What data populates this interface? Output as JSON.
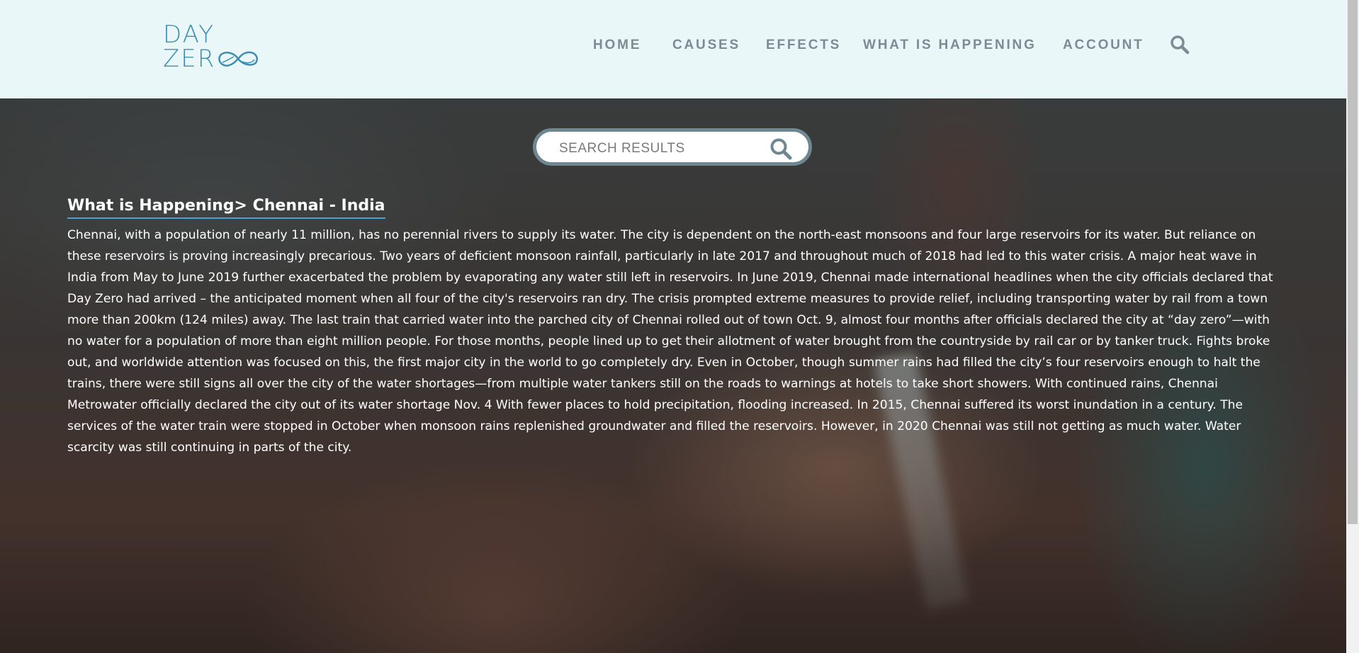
{
  "brand": {
    "line1": "DAY",
    "line2": "ZER"
  },
  "nav": {
    "items": [
      {
        "label": "HOME"
      },
      {
        "label": "CAUSES"
      },
      {
        "label": "EFFECTS"
      },
      {
        "label": "WHAT IS HAPPENING"
      },
      {
        "label": "ACCOUNT"
      }
    ],
    "search_icon": "search-icon"
  },
  "search": {
    "placeholder": "SEARCH RESULTS",
    "value": "",
    "icon": "search-icon"
  },
  "article": {
    "breadcrumb": "What is Happening> Chennai - India",
    "body": "Chennai, with a population of nearly 11 million, has no perennial rivers to supply its water. The city is dependent on the north-east monsoons and four large reservoirs for its water. But reliance on these reservoirs is proving increasingly precarious. Two years of deficient monsoon rainfall, particularly in late 2017 and throughout much of 2018 had led to this water crisis. A major heat wave in India from May to June 2019 further exacerbated the problem by evaporating any water still left in reservoirs. In June 2019, Chennai made international headlines when the city officials declared that Day Zero had arrived – the anticipated moment when all four of the city's reservoirs ran dry. The crisis prompted extreme measures to provide relief, including transporting water by rail from a town more than 200km (124 miles) away. The last train that carried water into the parched city of Chennai rolled out of town Oct. 9, almost four months after officials declared the city at “day zero”—with no water for a population of more than eight million people. For those months, people lined up to get their allotment of water brought from the countryside by rail car or by tanker truck. Fights broke out, and worldwide attention was focused on this, the first major city in the world to go completely dry. Even in October, though summer rains had filled the city’s four reservoirs enough to halt the trains, there were still signs all over the city of the water shortages—from multiple water tankers still on the roads to warnings at hotels to take short showers. With continued rains, Chennai Metrowater officially declared the city out of its water shortage Nov. 4 With fewer places to hold precipitation, flooding increased. In 2015, Chennai suffered its worst inundation in a century. The services of the water train were stopped in October when monsoon rains replenished groundwater and filled the reservoirs. However, in 2020 Chennai was still not getting as much water. Water scarcity was still continuing in parts of the city."
  },
  "colors": {
    "header_bg": "#eaf7f8",
    "logo": "#3c8fb0",
    "nav_text": "#7d8b96",
    "search_border": "#6e8791",
    "breadcrumb_underline": "#4e9fd6"
  }
}
